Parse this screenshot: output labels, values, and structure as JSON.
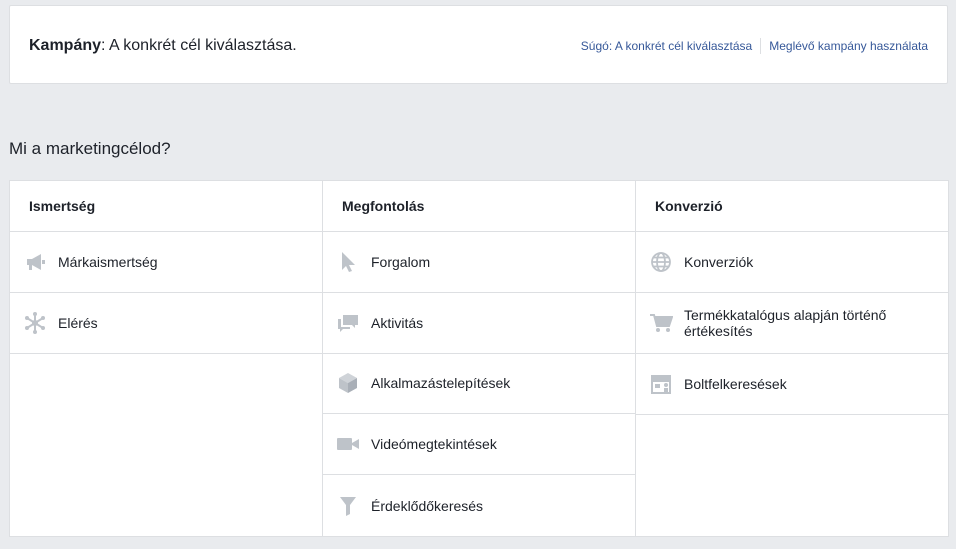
{
  "header": {
    "title_bold": "Kampány",
    "title_rest": ": A konkrét cél kiválasztása.",
    "help_link": "Súgó: A konkrét cél kiválasztása",
    "existing_link": "Meglévő kampány használata"
  },
  "question": "Mi a marketingcélod?",
  "colors": {
    "icon": "#bec3c9",
    "link": "#365899",
    "border": "#dddfe2"
  },
  "columns": [
    {
      "title": "Ismertség",
      "items": [
        {
          "label": "Márkaismertség",
          "icon": "megaphone-icon"
        },
        {
          "label": "Elérés",
          "icon": "reach-icon"
        }
      ]
    },
    {
      "title": "Megfontolás",
      "items": [
        {
          "label": "Forgalom",
          "icon": "cursor-icon"
        },
        {
          "label": "Aktivitás",
          "icon": "chat-bubbles-icon"
        },
        {
          "label": "Alkalmazástelepítések",
          "icon": "box-icon"
        },
        {
          "label": "Videómegtekintések",
          "icon": "video-camera-icon"
        },
        {
          "label": "Érdeklődőkeresés",
          "icon": "funnel-icon"
        }
      ]
    },
    {
      "title": "Konverzió",
      "items": [
        {
          "label": "Konverziók",
          "icon": "globe-icon"
        },
        {
          "label": "Termékkatalógus alapján történő értékesítés",
          "icon": "cart-icon"
        },
        {
          "label": "Boltfelkeresések",
          "icon": "store-icon"
        }
      ]
    }
  ]
}
